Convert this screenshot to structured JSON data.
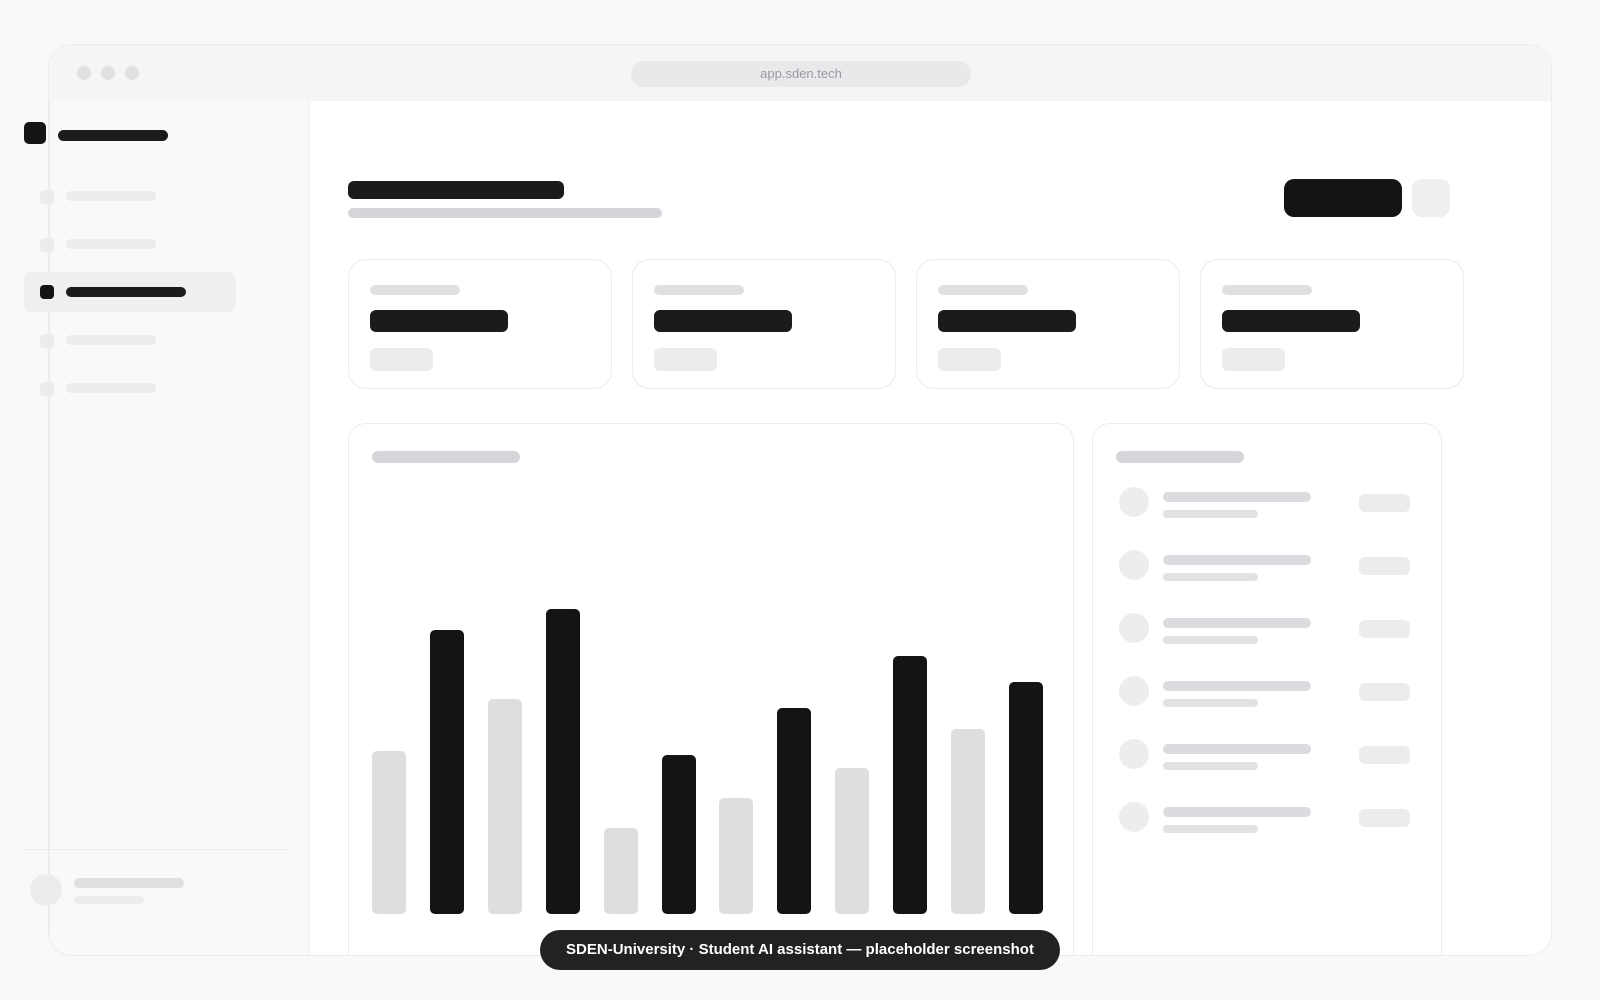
{
  "browser": {
    "url": "app.sden.tech"
  },
  "caption": {
    "text": "SDEN-University · Student AI assistant — placeholder screenshot"
  },
  "colors": {
    "placeholder_dark": "#1b1b1e",
    "placeholder_mid": "#d6d6da",
    "placeholder_light": "#ececee",
    "chart_dark": "#141416",
    "chart_light": "#dedede"
  },
  "chart_data": {
    "type": "bar",
    "categories": [
      "",
      "",
      "",
      "",
      "",
      "",
      "",
      "",
      "",
      "",
      "",
      ""
    ],
    "values": [
      38,
      66,
      50,
      71,
      20,
      37,
      27,
      48,
      34,
      60,
      43,
      54
    ],
    "ylim": [
      0,
      100
    ],
    "grid": false,
    "title": "",
    "xlabel": "",
    "ylabel": ""
  }
}
